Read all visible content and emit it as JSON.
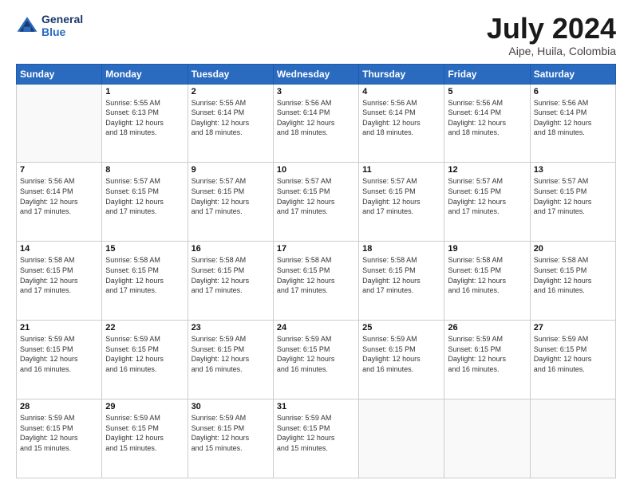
{
  "header": {
    "logo_line1": "General",
    "logo_line2": "Blue",
    "title": "July 2024",
    "subtitle": "Aipe, Huila, Colombia"
  },
  "weekdays": [
    "Sunday",
    "Monday",
    "Tuesday",
    "Wednesday",
    "Thursday",
    "Friday",
    "Saturday"
  ],
  "weeks": [
    [
      {
        "day": "",
        "info": ""
      },
      {
        "day": "1",
        "info": "Sunrise: 5:55 AM\nSunset: 6:13 PM\nDaylight: 12 hours\nand 18 minutes."
      },
      {
        "day": "2",
        "info": "Sunrise: 5:55 AM\nSunset: 6:14 PM\nDaylight: 12 hours\nand 18 minutes."
      },
      {
        "day": "3",
        "info": "Sunrise: 5:56 AM\nSunset: 6:14 PM\nDaylight: 12 hours\nand 18 minutes."
      },
      {
        "day": "4",
        "info": "Sunrise: 5:56 AM\nSunset: 6:14 PM\nDaylight: 12 hours\nand 18 minutes."
      },
      {
        "day": "5",
        "info": "Sunrise: 5:56 AM\nSunset: 6:14 PM\nDaylight: 12 hours\nand 18 minutes."
      },
      {
        "day": "6",
        "info": "Sunrise: 5:56 AM\nSunset: 6:14 PM\nDaylight: 12 hours\nand 18 minutes."
      }
    ],
    [
      {
        "day": "7",
        "info": "Sunrise: 5:56 AM\nSunset: 6:14 PM\nDaylight: 12 hours\nand 17 minutes."
      },
      {
        "day": "8",
        "info": "Sunrise: 5:57 AM\nSunset: 6:15 PM\nDaylight: 12 hours\nand 17 minutes."
      },
      {
        "day": "9",
        "info": "Sunrise: 5:57 AM\nSunset: 6:15 PM\nDaylight: 12 hours\nand 17 minutes."
      },
      {
        "day": "10",
        "info": "Sunrise: 5:57 AM\nSunset: 6:15 PM\nDaylight: 12 hours\nand 17 minutes."
      },
      {
        "day": "11",
        "info": "Sunrise: 5:57 AM\nSunset: 6:15 PM\nDaylight: 12 hours\nand 17 minutes."
      },
      {
        "day": "12",
        "info": "Sunrise: 5:57 AM\nSunset: 6:15 PM\nDaylight: 12 hours\nand 17 minutes."
      },
      {
        "day": "13",
        "info": "Sunrise: 5:57 AM\nSunset: 6:15 PM\nDaylight: 12 hours\nand 17 minutes."
      }
    ],
    [
      {
        "day": "14",
        "info": "Sunrise: 5:58 AM\nSunset: 6:15 PM\nDaylight: 12 hours\nand 17 minutes."
      },
      {
        "day": "15",
        "info": "Sunrise: 5:58 AM\nSunset: 6:15 PM\nDaylight: 12 hours\nand 17 minutes."
      },
      {
        "day": "16",
        "info": "Sunrise: 5:58 AM\nSunset: 6:15 PM\nDaylight: 12 hours\nand 17 minutes."
      },
      {
        "day": "17",
        "info": "Sunrise: 5:58 AM\nSunset: 6:15 PM\nDaylight: 12 hours\nand 17 minutes."
      },
      {
        "day": "18",
        "info": "Sunrise: 5:58 AM\nSunset: 6:15 PM\nDaylight: 12 hours\nand 17 minutes."
      },
      {
        "day": "19",
        "info": "Sunrise: 5:58 AM\nSunset: 6:15 PM\nDaylight: 12 hours\nand 16 minutes."
      },
      {
        "day": "20",
        "info": "Sunrise: 5:58 AM\nSunset: 6:15 PM\nDaylight: 12 hours\nand 16 minutes."
      }
    ],
    [
      {
        "day": "21",
        "info": "Sunrise: 5:59 AM\nSunset: 6:15 PM\nDaylight: 12 hours\nand 16 minutes."
      },
      {
        "day": "22",
        "info": "Sunrise: 5:59 AM\nSunset: 6:15 PM\nDaylight: 12 hours\nand 16 minutes."
      },
      {
        "day": "23",
        "info": "Sunrise: 5:59 AM\nSunset: 6:15 PM\nDaylight: 12 hours\nand 16 minutes."
      },
      {
        "day": "24",
        "info": "Sunrise: 5:59 AM\nSunset: 6:15 PM\nDaylight: 12 hours\nand 16 minutes."
      },
      {
        "day": "25",
        "info": "Sunrise: 5:59 AM\nSunset: 6:15 PM\nDaylight: 12 hours\nand 16 minutes."
      },
      {
        "day": "26",
        "info": "Sunrise: 5:59 AM\nSunset: 6:15 PM\nDaylight: 12 hours\nand 16 minutes."
      },
      {
        "day": "27",
        "info": "Sunrise: 5:59 AM\nSunset: 6:15 PM\nDaylight: 12 hours\nand 16 minutes."
      }
    ],
    [
      {
        "day": "28",
        "info": "Sunrise: 5:59 AM\nSunset: 6:15 PM\nDaylight: 12 hours\nand 15 minutes."
      },
      {
        "day": "29",
        "info": "Sunrise: 5:59 AM\nSunset: 6:15 PM\nDaylight: 12 hours\nand 15 minutes."
      },
      {
        "day": "30",
        "info": "Sunrise: 5:59 AM\nSunset: 6:15 PM\nDaylight: 12 hours\nand 15 minutes."
      },
      {
        "day": "31",
        "info": "Sunrise: 5:59 AM\nSunset: 6:15 PM\nDaylight: 12 hours\nand 15 minutes."
      },
      {
        "day": "",
        "info": ""
      },
      {
        "day": "",
        "info": ""
      },
      {
        "day": "",
        "info": ""
      }
    ]
  ]
}
